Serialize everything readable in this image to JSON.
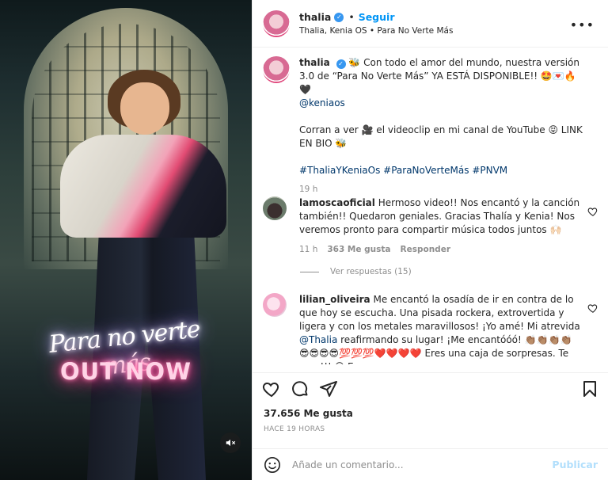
{
  "media": {
    "overlay_title": "Para no verte más",
    "overlay_subtitle": "OUT NOW",
    "mute_icon": "speaker-muted-icon"
  },
  "header": {
    "username": "thalia",
    "follow_label": "Seguir",
    "subtitle": "Thalia, Kenia OS • Para No Verte Más",
    "more_icon": "more-options-icon"
  },
  "caption": {
    "username": "thalia",
    "line1": "🐝 Con todo el amor del mundo, nuestra versión 3.0 de “Para No Verte Más” YA ESTÁ DISPONIBLE!! 🤩💌🔥🖤",
    "mention": "@keniaos",
    "line2": "Corran a ver 🎥 el videoclip en mi canal de YouTube 😝 LINK EN BIO 🐝",
    "hashtags": "#ThaliaYKeniaOs #ParaNoVerteMás #PNVM",
    "age": "19 h"
  },
  "comments": [
    {
      "username": "lamoscaoficial",
      "text": "Hermoso video!! Nos encantó y la canción también!! Quedaron geniales. Gracias Thalía y Kenia! Nos veremos pronto para compartir música todos juntos 🙌🏻",
      "age": "11 h",
      "likes": "363 Me gusta",
      "reply_label": "Responder",
      "view_replies": "Ver respuestas (15)"
    },
    {
      "username": "lilian_oliveira",
      "text": "Me encantó la osadía de ir en contra de lo que hoy se escucha. Una pisada rockera, extrovertida y ligera y con los metales maravillosos! ¡Yo amé! Mi atrevida",
      "mention": "@Thalia",
      "text2": "reafirmando su lugar! ¡Me encantóóó! 👏🏽👏🏽👏🏽👏🏽",
      "text3": "😎😎😎😎💯💯💯❤️❤️❤️❤️ Eres una caja de sorpresas. Te amo!!! 😍 Esa"
    }
  ],
  "actions": {
    "like_icon": "heart-icon",
    "comment_icon": "comment-icon",
    "share_icon": "share-icon",
    "save_icon": "bookmark-icon"
  },
  "likes_count": "37.656 Me gusta",
  "timestamp": "HACE 19 HORAS",
  "add_comment": {
    "emoji_icon": "emoji-icon",
    "placeholder": "Añade un comentario...",
    "publish_label": "Publicar"
  },
  "colors": {
    "link_blue": "#0095f6",
    "hashtag_blue": "#00376b",
    "muted_gray": "#8e8e8e"
  }
}
